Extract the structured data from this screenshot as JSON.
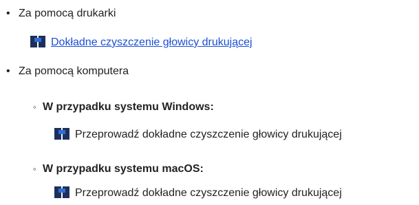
{
  "list": {
    "bullet_glyph": "•",
    "sub_bullet_glyph": "◦",
    "items": [
      {
        "label": "Za pomocą drukarki",
        "link_text": "Dokładne czyszczenie głowicy drukującej"
      },
      {
        "label": "Za pomocą komputera",
        "subitems": [
          {
            "label": "W przypadku systemu Windows:",
            "text": "Przeprowadź dokładne czyszczenie głowicy drukującej"
          },
          {
            "label": "W przypadku systemu macOS:",
            "text": "Przeprowadź dokładne czyszczenie głowicy drukującej"
          }
        ]
      }
    ]
  },
  "colors": {
    "link": "#1a4fd6",
    "text": "#222222",
    "icon_dark": "#1d2f5c",
    "icon_light": "#2f6fd1"
  },
  "icons": {
    "reference_icon": "page-reference-icon"
  }
}
